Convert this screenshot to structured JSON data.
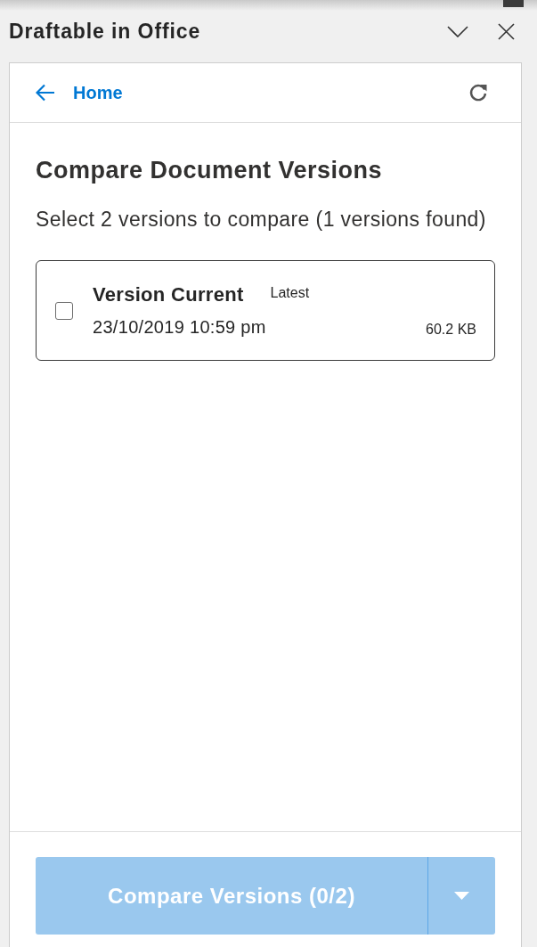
{
  "title_bar": {
    "title": "Draftable in Office"
  },
  "nav": {
    "back_label": "Home"
  },
  "page": {
    "heading": "Compare Document Versions",
    "subtitle": "Select 2 versions to compare (1 versions found)"
  },
  "versions": [
    {
      "name": "Version Current",
      "tag": "Latest",
      "date": "23/10/2019 10:59 pm",
      "size": "60.2 KB",
      "checked": false
    }
  ],
  "footer": {
    "compare_button": {
      "label": "Compare Versions (0/2)",
      "disabled": true
    }
  }
}
